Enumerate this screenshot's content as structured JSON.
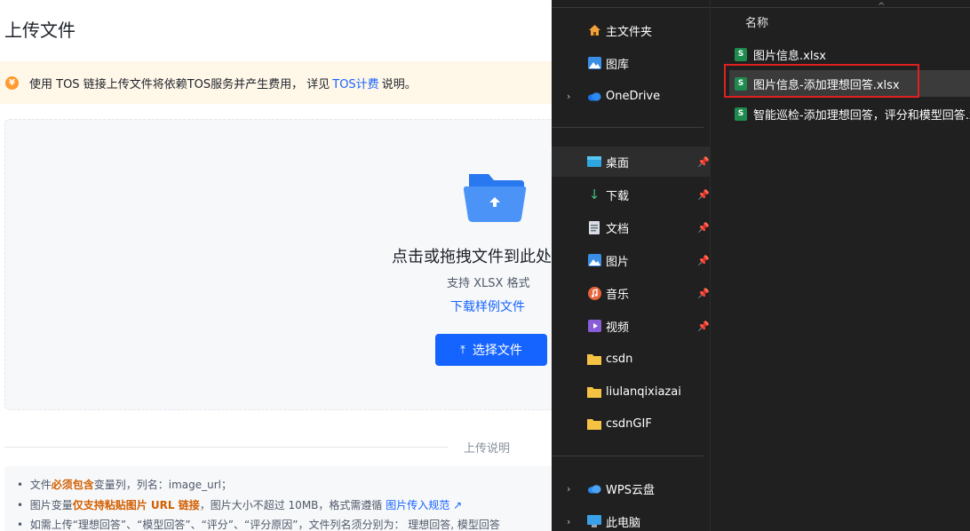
{
  "upload": {
    "title": "上传文件",
    "notice": {
      "before": "使用 TOS 链接上传文件将依赖TOS服务并产生费用， 详见",
      "link": "TOS计费",
      "after": "说明。"
    },
    "dropzone": {
      "title": "点击或拖拽文件到此处",
      "subtitle": "支持 XLSX 格式",
      "sample_link": "下载样例文件",
      "button_label": "选择文件"
    },
    "instructions_label": "上传说明",
    "notes": [
      {
        "prefix": "文件",
        "bold": "必须包含",
        "suffix": "变量列，列名：image_url；"
      },
      {
        "prefix": "图片变量",
        "bold": "仅支持粘贴图片 URL 链接",
        "suffix": "，图片大小不超过 10MB，格式需遵循",
        "link": "图片传入规范"
      },
      {
        "text": "如需上传“理想回答”、“模型回答”、“评分”、“评分原因”，文件列名须分别为： 理想回答, 模型回答"
      }
    ]
  },
  "explorer": {
    "sidebar": [
      {
        "label": "主文件夹",
        "icon": "home-icon"
      },
      {
        "label": "图库",
        "icon": "gallery-icon"
      },
      {
        "label": "OneDrive",
        "icon": "cloud-icon",
        "expandable": true
      },
      {
        "label": "桌面",
        "icon": "desktop-icon",
        "pinned": true,
        "selected": true
      },
      {
        "label": "下载",
        "icon": "download-icon",
        "pinned": true
      },
      {
        "label": "文档",
        "icon": "document-icon",
        "pinned": true
      },
      {
        "label": "图片",
        "icon": "pictures-icon",
        "pinned": true
      },
      {
        "label": "音乐",
        "icon": "music-icon",
        "pinned": true
      },
      {
        "label": "视频",
        "icon": "video-icon",
        "pinned": true
      },
      {
        "label": "csdn",
        "icon": "folder-icon"
      },
      {
        "label": "liulanqixiazai",
        "icon": "folder-icon"
      },
      {
        "label": "csdnGIF",
        "icon": "folder-icon"
      },
      {
        "label": "WPS云盘",
        "icon": "cloud-icon",
        "expandable": true
      },
      {
        "label": "此电脑",
        "icon": "computer-icon",
        "expandable": true
      }
    ],
    "column_header": "名称",
    "files": [
      {
        "name": "图片信息.xlsx",
        "selected": false
      },
      {
        "name": "图片信息-添加理想回答.xlsx",
        "selected": true
      },
      {
        "name": "智能巡检-添加理想回答，评分和模型回答.xlsx",
        "selected": false
      }
    ]
  },
  "colors": {
    "primary": "#1664ff",
    "warning_bg": "#fff7e8",
    "warning_icon": "#ff9a2e",
    "explorer_bg": "#202020",
    "highlight": "#e02020"
  }
}
